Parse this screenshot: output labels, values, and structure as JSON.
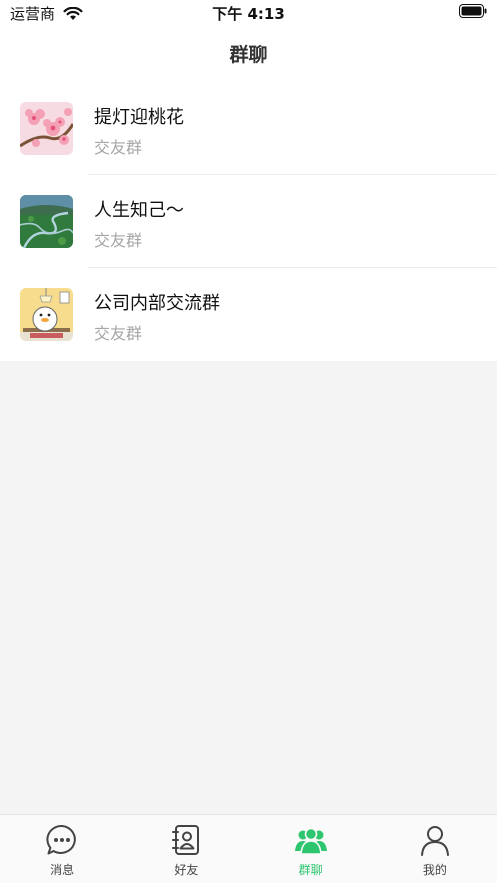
{
  "status_bar": {
    "carrier": "运营商",
    "time": "下午 4:13"
  },
  "header": {
    "title": "群聊"
  },
  "groups": [
    {
      "name": "提灯迎桃花",
      "type": "交友群",
      "avatar_icon": "peach-blossom-avatar"
    },
    {
      "name": "人生知己～",
      "type": "交友群",
      "avatar_icon": "green-landscape-avatar"
    },
    {
      "name": "公司内部交流群",
      "type": "交友群",
      "avatar_icon": "cartoon-duck-avatar"
    }
  ],
  "tab_bar": {
    "tabs": [
      {
        "label": "消息",
        "icon": "chat-bubble-icon",
        "active": false
      },
      {
        "label": "好友",
        "icon": "contacts-book-icon",
        "active": false
      },
      {
        "label": "群聊",
        "icon": "group-people-icon",
        "active": true
      },
      {
        "label": "我的",
        "icon": "person-icon",
        "active": false
      }
    ],
    "active_color": "#2ec56f",
    "inactive_color": "#444444"
  }
}
